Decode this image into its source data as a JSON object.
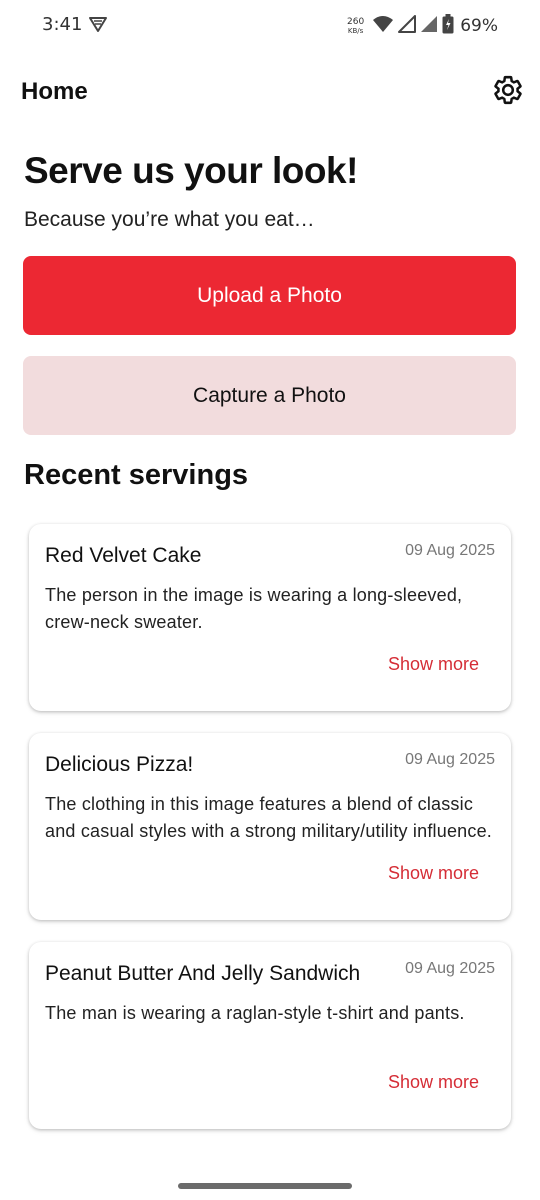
{
  "status_bar": {
    "time": "3:41",
    "net_speed_value": "260",
    "net_speed_unit": "KB/s",
    "battery_percent": "69%"
  },
  "header": {
    "title": "Home",
    "settings_icon": "gear-icon"
  },
  "hero": {
    "title": "Serve us your look!",
    "subtitle": "Because you’re what you eat…"
  },
  "actions": {
    "upload_label": "Upload a Photo",
    "capture_label": "Capture a Photo"
  },
  "recent": {
    "title": "Recent servings",
    "items": [
      {
        "title": "Red Velvet Cake",
        "date": "09 Aug 2025",
        "description": "The person in the image is wearing a long-sleeved, crew-neck sweater.",
        "more_label": "Show more"
      },
      {
        "title": "Delicious Pizza!",
        "date": "09 Aug 2025",
        "description": "The clothing in this image features a blend of classic and casual styles with a strong military/utility influence.",
        "more_label": "Show more"
      },
      {
        "title": "Peanut Butter And Jelly Sandwich",
        "date": "09 Aug 2025",
        "description": "The man is wearing a raglan-style t-shirt and pants.",
        "more_label": "Show more"
      }
    ]
  },
  "colors": {
    "primary": "#ec2833",
    "secondary_bg": "#f2dcdd",
    "link": "#d52d36"
  }
}
